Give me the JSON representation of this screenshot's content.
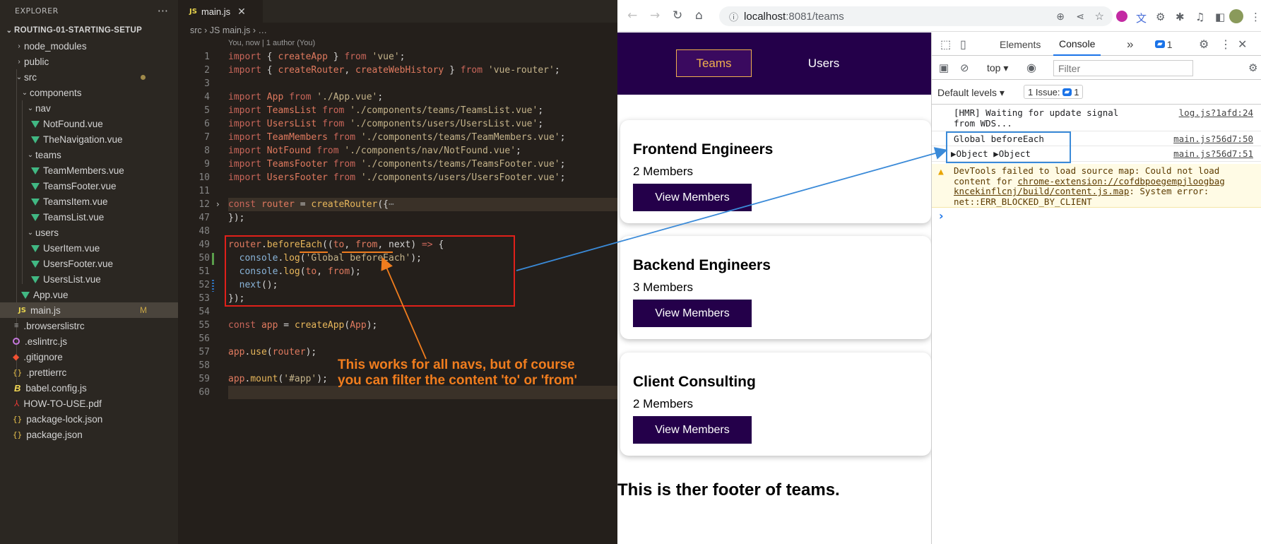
{
  "sidebar": {
    "title": "EXPLORER",
    "more": "···",
    "root": "ROUTING-01-STARTING-SETUP",
    "items": [
      {
        "label": "node_modules"
      },
      {
        "label": "public"
      },
      {
        "label": "src"
      },
      {
        "label": "components"
      },
      {
        "label": "nav"
      },
      {
        "label": "NotFound.vue"
      },
      {
        "label": "TheNavigation.vue"
      },
      {
        "label": "teams"
      },
      {
        "label": "TeamMembers.vue"
      },
      {
        "label": "TeamsFooter.vue"
      },
      {
        "label": "TeamsItem.vue"
      },
      {
        "label": "TeamsList.vue"
      },
      {
        "label": "users"
      },
      {
        "label": "UserItem.vue"
      },
      {
        "label": "UsersFooter.vue"
      },
      {
        "label": "UsersList.vue"
      },
      {
        "label": "App.vue"
      },
      {
        "label": "main.js",
        "badge": "M"
      },
      {
        "label": ".browserslistrc"
      },
      {
        "label": ".eslintrc.js"
      },
      {
        "label": ".gitignore"
      },
      {
        "label": ".prettierrc"
      },
      {
        "label": "babel.config.js"
      },
      {
        "label": "HOW-TO-USE.pdf"
      },
      {
        "label": "package-lock.json"
      },
      {
        "label": "package.json"
      }
    ]
  },
  "editor": {
    "tab_icon": "JS",
    "tab_label": "main.js",
    "breadcrumb": "src  ›  JS main.js  ›  …",
    "blame": "You, now | 1 author (You)",
    "line_numbers": [
      "1",
      "2",
      "3",
      "4",
      "5",
      "6",
      "7",
      "8",
      "9",
      "10",
      "11",
      "12",
      "47",
      "48",
      "49",
      "50",
      "51",
      "52",
      "53",
      "54",
      "55",
      "56",
      "57",
      "58",
      "59",
      "60"
    ]
  },
  "annotation": {
    "line1": "This works for all navs, but of course",
    "line2": "you can filter the content 'to' or 'from'"
  },
  "browser": {
    "url_host": "localhost",
    "url_rest": ":8081/teams",
    "nav": {
      "teams": "Teams",
      "users": "Users"
    },
    "teams": [
      {
        "name": "Frontend Engineers",
        "members": "2 Members",
        "button": "View Members"
      },
      {
        "name": "Backend Engineers",
        "members": "3 Members",
        "button": "View Members"
      },
      {
        "name": "Client Consulting",
        "members": "2 Members",
        "button": "View Members"
      }
    ],
    "footer": "This is ther footer of teams."
  },
  "devtools": {
    "tabs": {
      "elements": "Elements",
      "console": "Console",
      "more": "»",
      "issues_count": "1"
    },
    "context": "top",
    "filter_placeholder": "Filter",
    "levels": "Default levels",
    "issues_label": "1 Issue:",
    "issues_count": "1",
    "logs": [
      {
        "msg": "[HMR] Waiting for update signal\nfrom WDS...",
        "src": "log.js?1afd:24"
      },
      {
        "msg": "Global beforeEach",
        "src": "main.js?56d7:50"
      },
      {
        "msg": "▶Object ▶Object",
        "src": "main.js?56d7:51"
      }
    ],
    "warning": {
      "pre": "DevTools failed to load source map: Could not load\ncontent for ",
      "link1": "chrome-extension://cofdbpoegempjloogbag",
      "link2": "kncekinflcnj/build/content.js.map",
      "post": ": System error:",
      "line4": "net::ERR_BLOCKED_BY_CLIENT"
    },
    "prompt": "›"
  }
}
